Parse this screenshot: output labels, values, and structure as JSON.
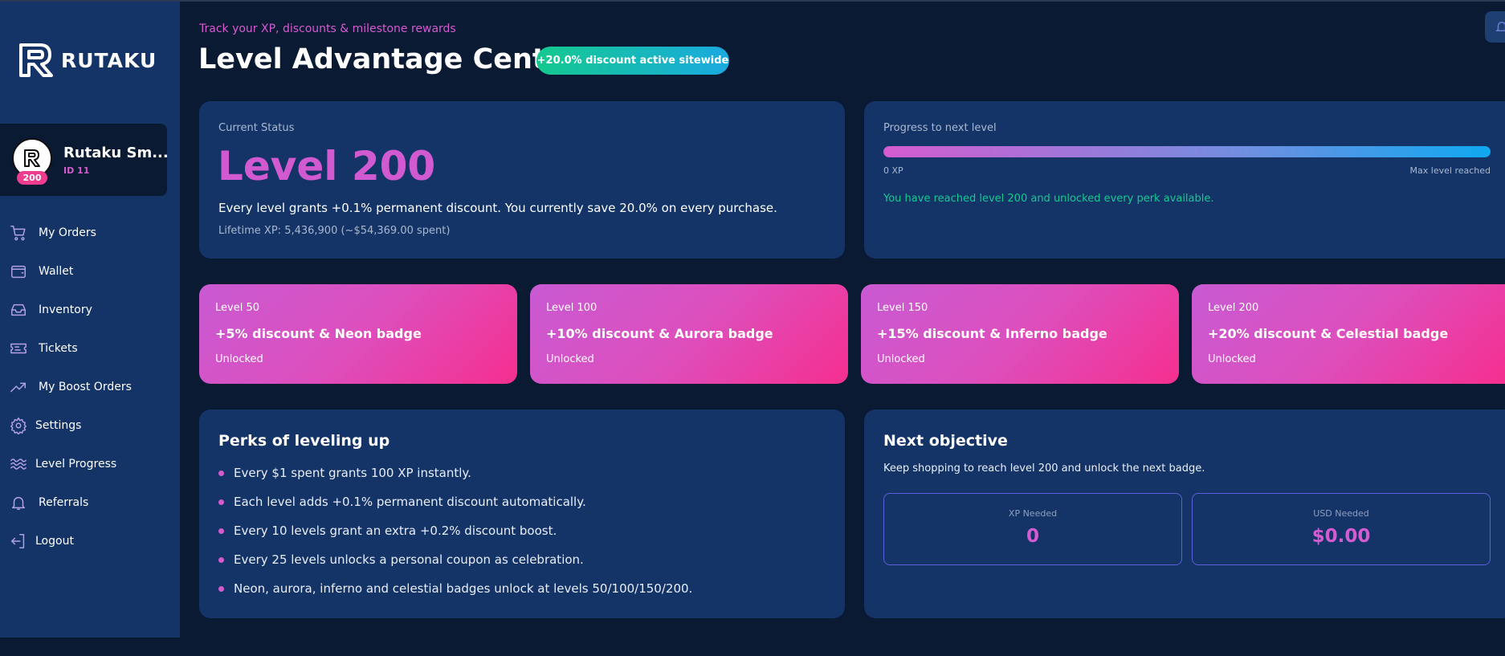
{
  "brand": {
    "name": "RUTAKU"
  },
  "user": {
    "name": "Rutaku Sm...",
    "id": "ID 11",
    "level_badge": "200"
  },
  "nav": {
    "items": [
      {
        "label": "My Orders",
        "icon": "cart-icon"
      },
      {
        "label": "Wallet",
        "icon": "wallet-icon"
      },
      {
        "label": "Inventory",
        "icon": "inventory-icon"
      },
      {
        "label": "Tickets",
        "icon": "ticket-icon"
      },
      {
        "label": "My Boost Orders",
        "icon": "trending-up-icon"
      },
      {
        "label": "Settings",
        "icon": "gear-icon"
      },
      {
        "label": "Level Progress",
        "icon": "waves-icon"
      },
      {
        "label": "Referrals",
        "icon": "bell-icon"
      },
      {
        "label": "Logout",
        "icon": "logout-icon"
      }
    ]
  },
  "header": {
    "subtitle": "Track your XP, discounts & milestone rewards",
    "title": "Level Advantage Center",
    "discount_pill": "+20.0% discount active sitewide"
  },
  "status": {
    "label": "Current Status",
    "level": "Level 200",
    "description": "Every level grants +0.1% permanent discount. You currently save 20.0% on every purchase.",
    "lifetime": "Lifetime XP: 5,436,900 (~$54,369.00 spent)"
  },
  "progress": {
    "label": "Progress to next level",
    "fraction": 1.0,
    "min_label": "0 XP",
    "max_label": "Max level reached",
    "message": "You have reached level 200 and unlocked every perk available."
  },
  "milestones": [
    {
      "level": "Level 50",
      "title": "+5% discount & Neon badge",
      "status": "Unlocked"
    },
    {
      "level": "Level 100",
      "title": "+10% discount & Aurora badge",
      "status": "Unlocked"
    },
    {
      "level": "Level 150",
      "title": "+15% discount & Inferno badge",
      "status": "Unlocked"
    },
    {
      "level": "Level 200",
      "title": "+20% discount & Celestial badge",
      "status": "Unlocked"
    }
  ],
  "perks": {
    "title": "Perks of leveling up",
    "items": [
      "Every $1 spent grants 100 XP instantly.",
      "Each level adds +0.1% permanent discount automatically.",
      "Every 10 levels grant an extra +0.2% discount boost.",
      "Every 25 levels unlocks a personal coupon as celebration.",
      "Neon, aurora, inferno and celestial badges unlock at levels 50/100/150/200."
    ]
  },
  "objective": {
    "title": "Next objective",
    "description": "Keep shopping to reach level 200 and unlock the next badge.",
    "xp_label": "XP Needed",
    "xp_value": "0",
    "usd_label": "USD Needed",
    "usd_value": "$0.00"
  },
  "colors": {
    "background": "#0b1a33",
    "panel": "#143468",
    "accent_pink": "#d55bd0",
    "accent_green": "#14c98f",
    "milestone_gradient_end": "#f52f8f"
  }
}
